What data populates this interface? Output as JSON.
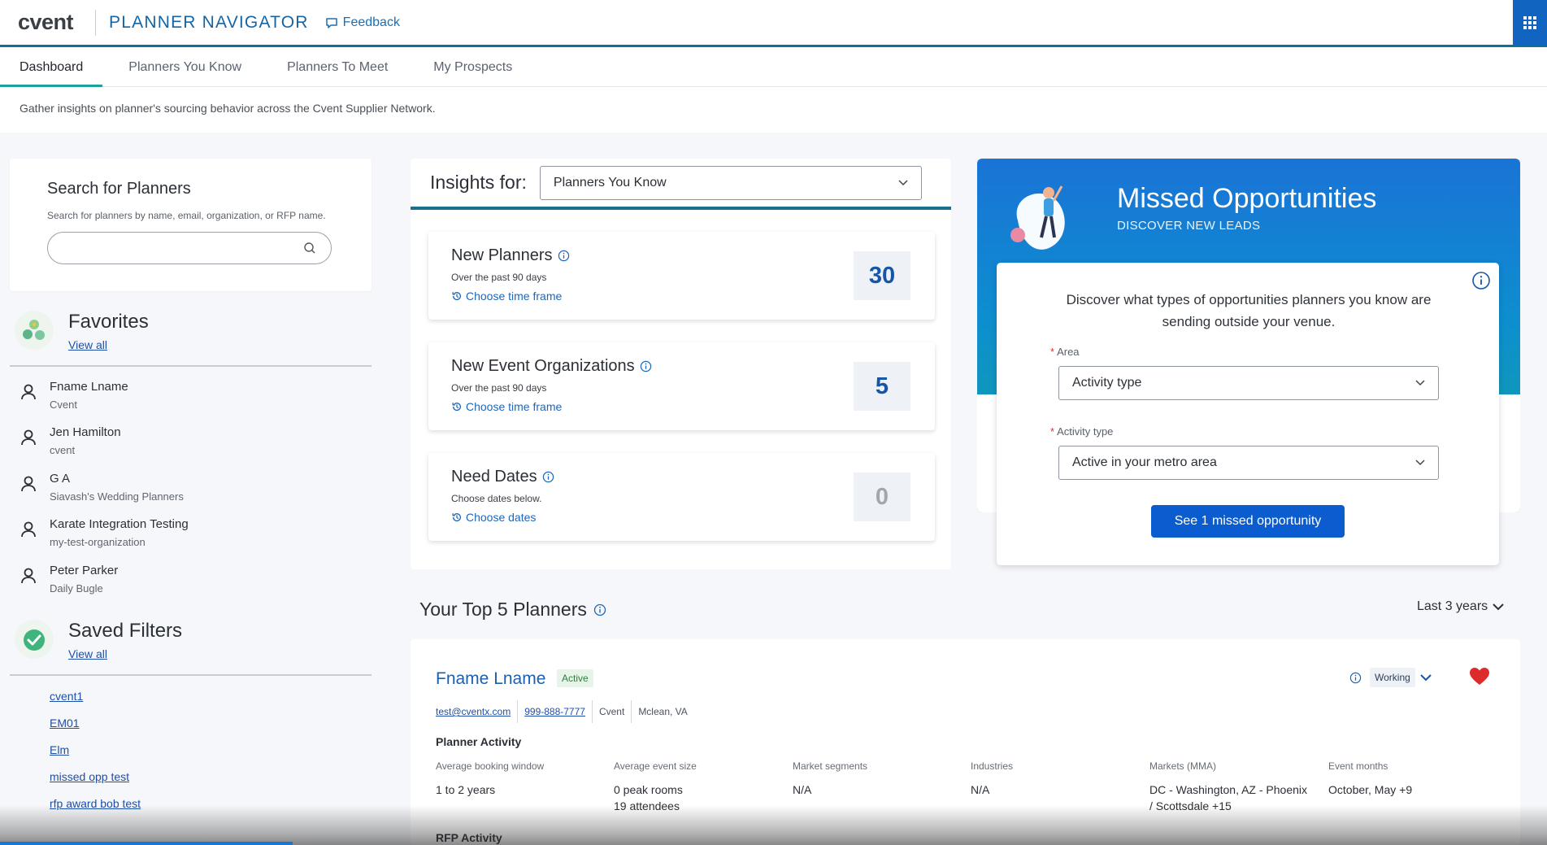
{
  "header": {
    "logo": "cvent",
    "product": "PLANNER NAVIGATOR",
    "feedback": "Feedback",
    "apps_icon": "grid-icon",
    "accent": "#0f6f95"
  },
  "tabs": [
    {
      "label": "Dashboard",
      "active": true
    },
    {
      "label": "Planners You Know"
    },
    {
      "label": "Planners To Meet"
    },
    {
      "label": "My Prospects"
    }
  ],
  "intro": "Gather insights on planner's sourcing behavior across the Cvent Supplier Network.",
  "search": {
    "title": "Search for Planners",
    "description": "Search for planners by name, email, organization, or RFP name.",
    "value": "",
    "placeholder": ""
  },
  "favorites": {
    "title": "Favorites",
    "view_all": "View all",
    "items": [
      {
        "name": "Fname Lname",
        "org": "Cvent"
      },
      {
        "name": "Jen Hamilton",
        "org": "cvent"
      },
      {
        "name": "G A",
        "org": "Siavash's Wedding Planners"
      },
      {
        "name": "Karate Integration Testing",
        "org": "my-test-organization"
      },
      {
        "name": "Peter Parker",
        "org": "Daily Bugle"
      }
    ]
  },
  "saved_filters": {
    "title": "Saved Filters",
    "view_all": "View all",
    "items": [
      "cvent1",
      "EM01",
      "Elm",
      "missed opp test",
      "rfp award bob test"
    ]
  },
  "insights": {
    "label": "Insights for:",
    "selected": "Planners You Know",
    "metrics": [
      {
        "title": "New Planners",
        "subtitle": "Over the past 90 days",
        "link": "Choose time frame",
        "value": "30"
      },
      {
        "title": "New Event Organizations",
        "subtitle": "Over the past 90 days",
        "link": "Choose time frame",
        "value": "5"
      },
      {
        "title": "Need Dates",
        "subtitle": "Choose dates below.",
        "link": "Choose dates",
        "value": "0"
      }
    ]
  },
  "missed": {
    "title": "Missed Opportunities",
    "subtitle": "DISCOVER NEW LEADS",
    "message": "Discover what types of opportunities planners you know are sending outside your venue.",
    "area_label": "Area",
    "area_value": "Activity type",
    "activity_label": "Activity type",
    "activity_value": "Active in your metro area",
    "cta": "See 1 missed opportunity",
    "required_mark": "*"
  },
  "top_planners": {
    "title": "Your Top 5 Planners",
    "range": "Last 3 years",
    "planner": {
      "name": "Fname Lname",
      "status": "Active",
      "email": "test@cventx.com",
      "phone": "999-888-7777",
      "org": "Cvent",
      "location": "Mclean, VA",
      "stage": "Working",
      "activity_heading": "Planner Activity",
      "columns": [
        {
          "label": "Average booking window",
          "value": "1 to 2 years",
          "value2": ""
        },
        {
          "label": "Average event size",
          "value": "0 peak rooms",
          "value2": "19 attendees"
        },
        {
          "label": "Market segments",
          "value": "N/A",
          "value2": ""
        },
        {
          "label": "Industries",
          "value": "N/A",
          "value2": ""
        },
        {
          "label": "Markets (MMA)",
          "value": "DC - Washington, AZ - Phoenix",
          "value2": "/ Scottsdale +15"
        },
        {
          "label": "Event months",
          "value": "October, May +9",
          "value2": ""
        }
      ],
      "rfp_heading": "RFP Activity"
    }
  }
}
